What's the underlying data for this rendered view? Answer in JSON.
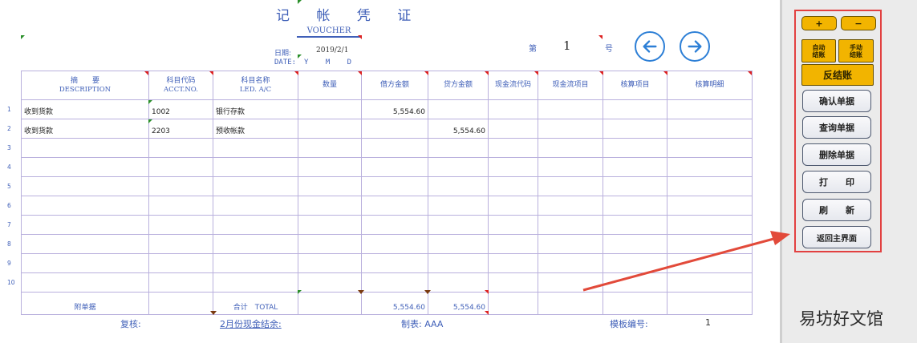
{
  "voucher": {
    "title": "记 帐 凭 证",
    "subtitle": "VOUCHER",
    "date_label": "日期:",
    "date_value": "2019/2/1",
    "date_en_label": "DATE:",
    "date_ymd": "Y M D",
    "number_prefix": "第",
    "number_value": "1",
    "number_suffix": "号"
  },
  "nav": {
    "prev_icon": "arrow-left-icon",
    "next_icon": "arrow-right-icon"
  },
  "table": {
    "headers": [
      {
        "cn": "摘　　要",
        "en": "DESCRIPTION"
      },
      {
        "cn": "科目代码",
        "en": "ACCT.NO."
      },
      {
        "cn": "科目名称",
        "en": "LED. A/C"
      },
      {
        "cn": "数量",
        "en": ""
      },
      {
        "cn": "借方金额",
        "en": ""
      },
      {
        "cn": "贷方金额",
        "en": ""
      },
      {
        "cn": "现金流代码",
        "en": ""
      },
      {
        "cn": "现金流项目",
        "en": ""
      },
      {
        "cn": "核算项目",
        "en": ""
      },
      {
        "cn": "核算明细",
        "en": ""
      }
    ],
    "row_numbers": [
      "1",
      "2",
      "3",
      "4",
      "5",
      "6",
      "7",
      "8",
      "9",
      "10"
    ],
    "rows": [
      [
        "收到货款",
        "1002",
        "银行存款",
        "",
        "5,554.60",
        "",
        "",
        "",
        "",
        ""
      ],
      [
        "收到货款",
        "2203",
        "预收帐款",
        "",
        "",
        "5,554.60",
        "",
        "",
        "",
        ""
      ],
      [
        "",
        "",
        "",
        "",
        "",
        "",
        "",
        "",
        "",
        ""
      ],
      [
        "",
        "",
        "",
        "",
        "",
        "",
        "",
        "",
        "",
        ""
      ],
      [
        "",
        "",
        "",
        "",
        "",
        "",
        "",
        "",
        "",
        ""
      ],
      [
        "",
        "",
        "",
        "",
        "",
        "",
        "",
        "",
        "",
        ""
      ],
      [
        "",
        "",
        "",
        "",
        "",
        "",
        "",
        "",
        "",
        ""
      ],
      [
        "",
        "",
        "",
        "",
        "",
        "",
        "",
        "",
        "",
        ""
      ],
      [
        "",
        "",
        "",
        "",
        "",
        "",
        "",
        "",
        "",
        ""
      ],
      [
        "",
        "",
        "",
        "",
        "",
        "",
        "",
        "",
        "",
        ""
      ]
    ],
    "total": {
      "attach_label": "附单据",
      "total_label": "合计　TOTAL",
      "debit": "5,554.60",
      "credit": "5,554.60"
    }
  },
  "footer": {
    "review_label": "复核:",
    "cash_balance_link": "2月份现金结余:",
    "maker_label": "制表: AAA",
    "template_label": "模板编号:",
    "template_value": "1"
  },
  "panel": {
    "plus": "+",
    "minus": "−",
    "auto_close": "自动\n结账",
    "manual_close": "手动\n结账",
    "reverse_close": "反结账",
    "confirm": "确认单据",
    "query": "查询单据",
    "delete": "删除单据",
    "print": "打　　印",
    "refresh": "刷　　新",
    "back": "返回主界面"
  },
  "watermark": "易坊好文馆",
  "colors": {
    "accent": "#3f5fb8",
    "highlight_border": "#e24040",
    "button_yellow": "#f2b400",
    "nav_blue": "#2d7fd6"
  }
}
